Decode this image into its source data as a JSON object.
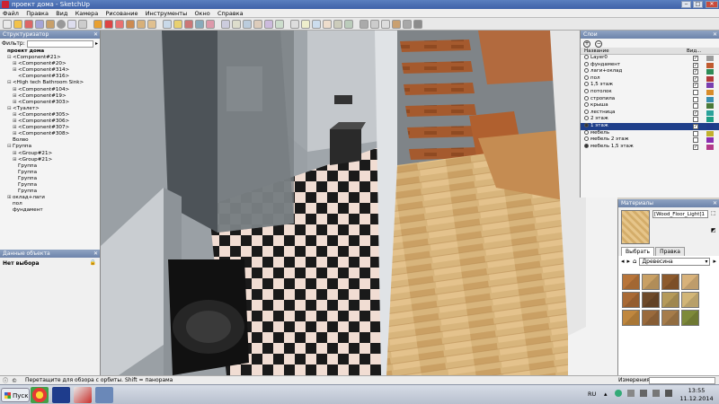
{
  "window": {
    "title": "проект дома - SketchUp"
  },
  "menu": [
    "Файл",
    "Правка",
    "Вид",
    "Камера",
    "Рисование",
    "Инструменты",
    "Окно",
    "Справка"
  ],
  "outliner": {
    "title": "Структуризатор",
    "filter_label": "Фильтр:",
    "items": [
      {
        "text": "проект дома",
        "level": 0,
        "toggle": ""
      },
      {
        "text": "<Component#21>",
        "level": 1,
        "toggle": "⊟"
      },
      {
        "text": "<Component#20>",
        "level": 2,
        "toggle": "⊞"
      },
      {
        "text": "<Component#314>",
        "level": 2,
        "toggle": "⊞"
      },
      {
        "text": "<Component#316>",
        "level": 2,
        "toggle": ""
      },
      {
        "text": "<High tech Bathroom Sink>",
        "level": 1,
        "toggle": "⊟"
      },
      {
        "text": "<Component#104>",
        "level": 2,
        "toggle": "⊞"
      },
      {
        "text": "<Component#19>",
        "level": 2,
        "toggle": "⊞"
      },
      {
        "text": "<Component#303>",
        "level": 2,
        "toggle": "⊞"
      },
      {
        "text": "<Туалет>",
        "level": 1,
        "toggle": "⊟"
      },
      {
        "text": "<Component#305>",
        "level": 2,
        "toggle": "⊞"
      },
      {
        "text": "<Component#306>",
        "level": 2,
        "toggle": "⊞"
      },
      {
        "text": "<Component#307>",
        "level": 2,
        "toggle": "⊞"
      },
      {
        "text": "<Component#308>",
        "level": 2,
        "toggle": "⊞"
      },
      {
        "text": "Волво",
        "level": 1,
        "toggle": ""
      },
      {
        "text": "Группа",
        "level": 1,
        "toggle": "⊟"
      },
      {
        "text": "<Group#21>",
        "level": 2,
        "toggle": "⊞"
      },
      {
        "text": "<Group#21>",
        "level": 2,
        "toggle": "⊞"
      },
      {
        "text": "Группа",
        "level": 2,
        "toggle": ""
      },
      {
        "text": "Группа",
        "level": 2,
        "toggle": ""
      },
      {
        "text": "Группа",
        "level": 2,
        "toggle": ""
      },
      {
        "text": "Группа",
        "level": 2,
        "toggle": ""
      },
      {
        "text": "Группа",
        "level": 2,
        "toggle": ""
      },
      {
        "text": "оклад+лаги",
        "level": 1,
        "toggle": "⊞"
      },
      {
        "text": "пол",
        "level": 1,
        "toggle": ""
      },
      {
        "text": "фундамент",
        "level": 1,
        "toggle": ""
      }
    ]
  },
  "entity_info": {
    "title": "Данные объекта",
    "status": "Нет выбора",
    "lock_icon": "lock-icon"
  },
  "layers": {
    "title": "Слои",
    "col_name": "Название",
    "col_visible": "Вид...",
    "rows": [
      {
        "name": "Layer0",
        "active": false,
        "visible": true,
        "color": "#9b9b9b"
      },
      {
        "name": "фундамент",
        "active": false,
        "visible": true,
        "color": "#c05a2f"
      },
      {
        "name": "лаги+оклад",
        "active": false,
        "visible": true,
        "color": "#2e8b57"
      },
      {
        "name": "пол",
        "active": false,
        "visible": true,
        "color": "#b23a3a"
      },
      {
        "name": "1,5 этаж",
        "active": false,
        "visible": true,
        "color": "#7a3fb0"
      },
      {
        "name": "потолок",
        "active": false,
        "visible": false,
        "color": "#d98c2b"
      },
      {
        "name": "стропила",
        "active": false,
        "visible": false,
        "color": "#3a8fb0"
      },
      {
        "name": "крыша",
        "active": false,
        "visible": false,
        "color": "#4a7a3a"
      },
      {
        "name": "лестница",
        "active": false,
        "visible": true,
        "color": "#2ba39b"
      },
      {
        "name": "2 этаж",
        "active": false,
        "visible": false,
        "color": "#1fa085"
      },
      {
        "name": "1 этаж",
        "active": true,
        "visible": true,
        "color": "#203a8a",
        "selected": true
      },
      {
        "name": "мебель",
        "active": false,
        "visible": false,
        "color": "#c2b02e"
      },
      {
        "name": "мебель 2 этаж",
        "active": false,
        "visible": false,
        "color": "#8a2db0"
      },
      {
        "name": "мебель 1,5 этаж",
        "active": true,
        "visible": true,
        "color": "#b23a8a"
      }
    ]
  },
  "materials": {
    "title": "Материалы",
    "current": "[Wood_Floor_Light]1",
    "tab_select": "Выбрать",
    "tab_edit": "Правка",
    "library": "Древесина",
    "swatches": [
      "#b8753a",
      "#c9a064",
      "#8d5a2c",
      "#d8b27a",
      "#a96a35",
      "#6e4a2a",
      "#b59a5a",
      "#d2b678",
      "#c0873e",
      "#9a6a3c",
      "#a67c4a",
      "#7e8a3a"
    ]
  },
  "status": {
    "hint": "Перетащите для обзора с орбиты.  Shift = панорама",
    "vcb_label": "Измерения"
  },
  "taskbar": {
    "start": "Пуск",
    "lang": "RU",
    "time": "13:55",
    "date": "11.12.2014"
  }
}
